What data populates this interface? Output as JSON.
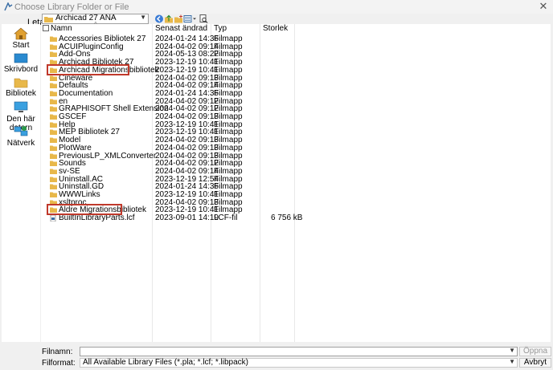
{
  "window": {
    "title": "Choose Library Folder or File",
    "close_label": "✕"
  },
  "lookin": {
    "label": "Leta i:",
    "value": "Archicad 27 ANA"
  },
  "places": [
    {
      "label": "Start"
    },
    {
      "label": "Skrivbord"
    },
    {
      "label": "Bibliotek"
    },
    {
      "label": "Den här datorn"
    },
    {
      "label": "Nätverk"
    }
  ],
  "columns": {
    "name": "Namn",
    "modified": "Senast ändrad",
    "type": "Typ",
    "size": "Storlek"
  },
  "files": [
    {
      "name": "Accessories Bibliotek 27",
      "date": "2024-01-24 14:36",
      "type": "Filmapp",
      "size": ""
    },
    {
      "name": "ACUIPluginConfig",
      "date": "2024-04-02 09:14",
      "type": "Filmapp",
      "size": ""
    },
    {
      "name": "Add-Ons",
      "date": "2024-05-13 08:22",
      "type": "Filmapp",
      "size": ""
    },
    {
      "name": "Archicad Bibliotek 27",
      "date": "2023-12-19 10:41",
      "type": "Filmapp",
      "size": ""
    },
    {
      "name": "Archicad Migrationsbibliotek",
      "date": "2023-12-19 10:41",
      "type": "Filmapp",
      "size": ""
    },
    {
      "name": "Cineware",
      "date": "2024-04-02 09:13",
      "type": "Filmapp",
      "size": ""
    },
    {
      "name": "Defaults",
      "date": "2024-04-02 09:14",
      "type": "Filmapp",
      "size": ""
    },
    {
      "name": "Documentation",
      "date": "2024-01-24 14:36",
      "type": "Filmapp",
      "size": ""
    },
    {
      "name": "en",
      "date": "2024-04-02 09:12",
      "type": "Filmapp",
      "size": ""
    },
    {
      "name": "GRAPHISOFT Shell Extension",
      "date": "2024-04-02 09:12",
      "type": "Filmapp",
      "size": ""
    },
    {
      "name": "GSCEF",
      "date": "2024-04-02 09:13",
      "type": "Filmapp",
      "size": ""
    },
    {
      "name": "Help",
      "date": "2023-12-19 10:41",
      "type": "Filmapp",
      "size": ""
    },
    {
      "name": "MEP Bibliotek 27",
      "date": "2023-12-19 10:41",
      "type": "Filmapp",
      "size": ""
    },
    {
      "name": "Model",
      "date": "2024-04-02 09:13",
      "type": "Filmapp",
      "size": ""
    },
    {
      "name": "PlotWare",
      "date": "2024-04-02 09:13",
      "type": "Filmapp",
      "size": ""
    },
    {
      "name": "PreviousLP_XMLConverter",
      "date": "2024-04-02 09:13",
      "type": "Filmapp",
      "size": ""
    },
    {
      "name": "Sounds",
      "date": "2024-04-02 09:12",
      "type": "Filmapp",
      "size": ""
    },
    {
      "name": "sv-SE",
      "date": "2024-04-02 09:14",
      "type": "Filmapp",
      "size": ""
    },
    {
      "name": "Uninstall.AC",
      "date": "2023-12-19 12:54",
      "type": "Filmapp",
      "size": ""
    },
    {
      "name": "Uninstall.GD",
      "date": "2024-01-24 14:36",
      "type": "Filmapp",
      "size": ""
    },
    {
      "name": "WWWLinks",
      "date": "2023-12-19 10:41",
      "type": "Filmapp",
      "size": ""
    },
    {
      "name": "xsltproc",
      "date": "2024-04-02 09:13",
      "type": "Filmapp",
      "size": ""
    },
    {
      "name": "Äldre Migrationsbibliotek",
      "date": "2023-12-19 10:41",
      "type": "Filmapp",
      "size": ""
    },
    {
      "name": "BuiltInLibraryParts.lcf",
      "date": "2023-09-01 14:19",
      "type": "LCF-fil",
      "size": "6 756 kB"
    }
  ],
  "filename": {
    "label": "Filnamn:",
    "value": ""
  },
  "filetype": {
    "label": "Filformat:",
    "value": "All Available Library Files (*.pla; *.lcf; *.libpack)"
  },
  "buttons": {
    "open": "Öppna",
    "cancel": "Avbryt"
  },
  "colors": {
    "highlight": "#c0392b",
    "folder": "#e8b84a"
  }
}
